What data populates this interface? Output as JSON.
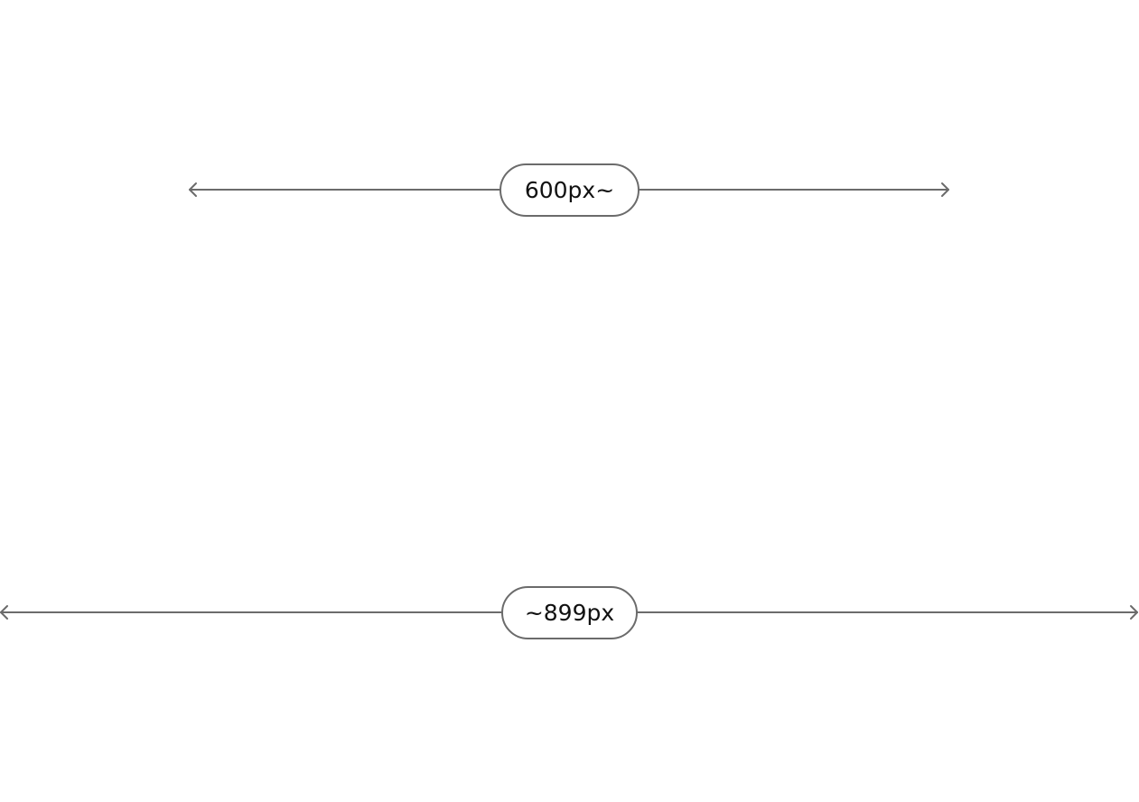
{
  "measurements": [
    {
      "label": "600px~"
    },
    {
      "label": "~899px"
    }
  ],
  "colors": {
    "line": "#6b6b6b",
    "text": "#111111"
  }
}
